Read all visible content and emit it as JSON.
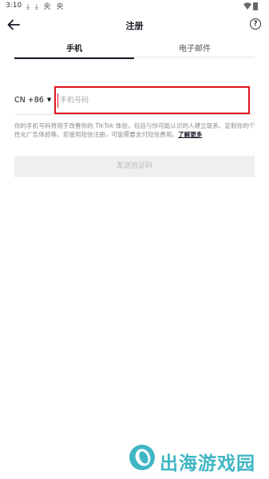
{
  "status_bar": {
    "time": "3:10",
    "notification_icons": "⤓ ⤓ 央 央"
  },
  "header": {
    "title": "注册"
  },
  "tabs": [
    {
      "label": "手机",
      "active": true
    },
    {
      "label": "电子邮件",
      "active": false
    }
  ],
  "phone_form": {
    "country_code": "CN +86",
    "phone_placeholder": "手机号码",
    "phone_value": ""
  },
  "disclaimer": {
    "text": "你的手机号码将用于改善你的 TikTok 体验，包括与你可能认识的人建立联系、定制你的个性化广告体验等。若使用短信注册，可能需要支付短信费用。",
    "link": "了解更多"
  },
  "send_button": {
    "label": "发送验证码",
    "enabled": false
  },
  "watermark": {
    "text": "出海游戏园"
  },
  "colors": {
    "highlight_border": "#e0141e",
    "watermark": "#3fb6c4",
    "disabled_button_bg": "#efeff0"
  }
}
